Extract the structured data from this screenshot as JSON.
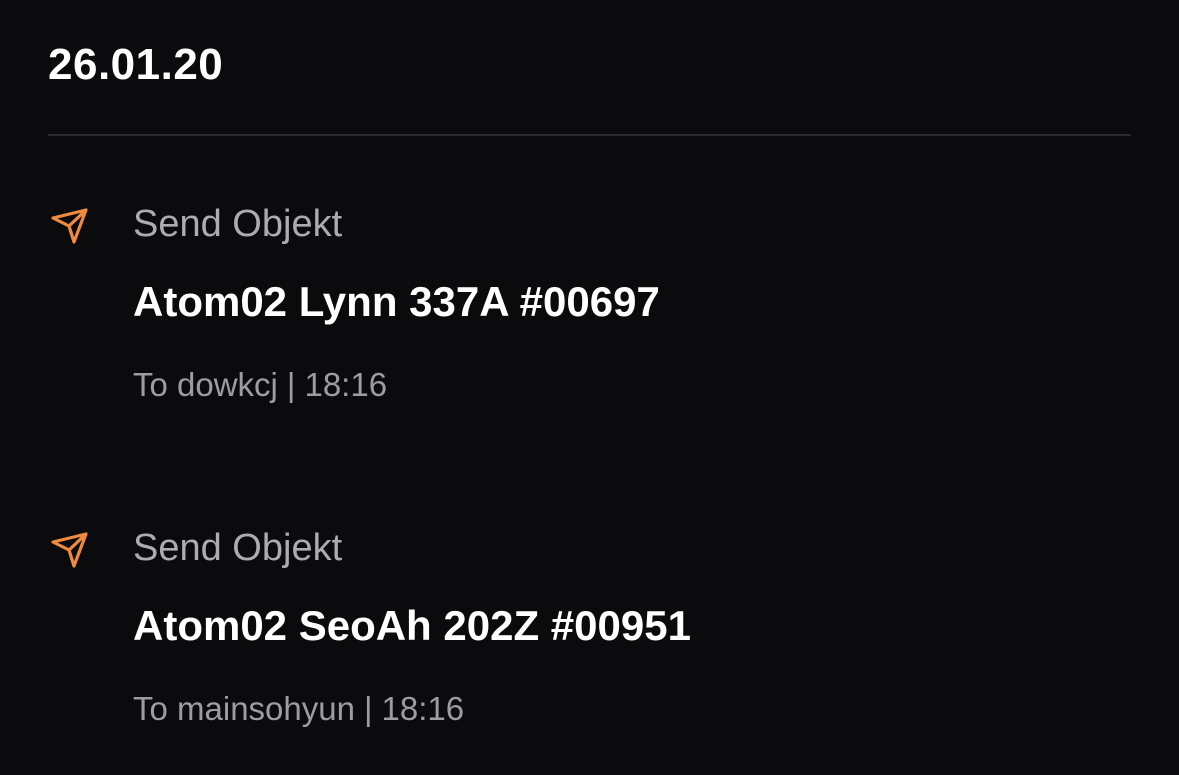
{
  "header": {
    "date": "26.01.20"
  },
  "colors": {
    "background": "#0b0b0d",
    "accent": "#f08a3c",
    "muted_text": "#a9acb1",
    "divider": "#2a2a2e"
  },
  "activities": [
    {
      "icon": "send-icon",
      "type_label": "Send Objekt",
      "objekt": "Atom02 Lynn 337A #00697",
      "recipient": "To dowkcj",
      "separator": "|",
      "time": "18:16"
    },
    {
      "icon": "send-icon",
      "type_label": "Send Objekt",
      "objekt": "Atom02 SeoAh 202Z #00951",
      "recipient": "To mainsohyun",
      "separator": "|",
      "time": "18:16"
    }
  ]
}
